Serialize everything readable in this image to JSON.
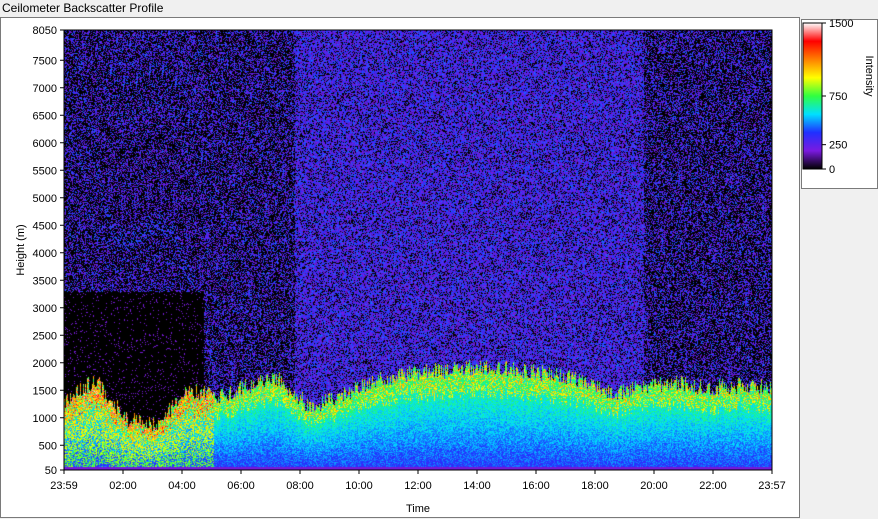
{
  "window": {
    "title": "Ceilometer Backscatter Profile"
  },
  "chart_data": {
    "type": "heatmap",
    "title": "Ceilometer Backscatter Profile",
    "xlabel": "Time",
    "ylabel": "Height (m)",
    "x_ticks": [
      "23:59",
      "02:00",
      "04:00",
      "06:00",
      "08:00",
      "10:00",
      "12:00",
      "14:00",
      "16:00",
      "18:00",
      "20:00",
      "22:00",
      "23:57"
    ],
    "y_ticks": [
      50,
      500,
      1000,
      1500,
      2000,
      2500,
      3000,
      3500,
      4000,
      4500,
      5000,
      5500,
      6000,
      6500,
      7000,
      7500,
      8050
    ],
    "ylim": [
      50,
      8050
    ],
    "colorbar": {
      "label": "Intensity",
      "ticks": [
        0,
        250,
        750,
        1500
      ],
      "tick_labels": [
        "0",
        "250",
        "750",
        "1500"
      ],
      "range": [
        0,
        1500
      ],
      "colors": [
        "#000000",
        "#7a1ae0",
        "#2030ff",
        "#00e0ff",
        "#30ff40",
        "#ffff00",
        "#ff8000",
        "#ff0000",
        "#ffffff"
      ]
    },
    "boundary_layer_top_m": [
      {
        "time": "23:59",
        "height": 1300
      },
      {
        "time": "01:00",
        "height": 1700
      },
      {
        "time": "02:00",
        "height": 1000
      },
      {
        "time": "03:00",
        "height": 900
      },
      {
        "time": "04:00",
        "height": 1500
      },
      {
        "time": "05:00",
        "height": 1400
      },
      {
        "time": "06:00",
        "height": 1600
      },
      {
        "time": "07:00",
        "height": 1700
      },
      {
        "time": "08:00",
        "height": 1200
      },
      {
        "time": "09:00",
        "height": 1400
      },
      {
        "time": "10:00",
        "height": 1650
      },
      {
        "time": "11:00",
        "height": 1800
      },
      {
        "time": "12:00",
        "height": 1850
      },
      {
        "time": "13:00",
        "height": 1900
      },
      {
        "time": "14:00",
        "height": 1950
      },
      {
        "time": "15:00",
        "height": 1850
      },
      {
        "time": "16:00",
        "height": 1800
      },
      {
        "time": "17:00",
        "height": 1650
      },
      {
        "time": "18:00",
        "height": 1450
      },
      {
        "time": "19:00",
        "height": 1600
      },
      {
        "time": "20:00",
        "height": 1650
      },
      {
        "time": "21:00",
        "height": 1550
      },
      {
        "time": "22:00",
        "height": 1600
      },
      {
        "time": "23:57",
        "height": 1550
      }
    ]
  }
}
